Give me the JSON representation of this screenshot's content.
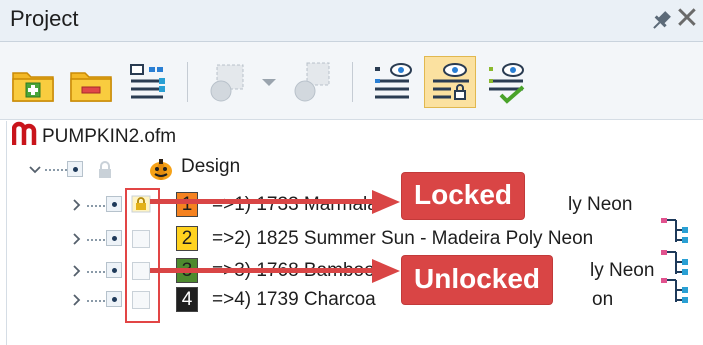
{
  "window": {
    "title": "Project",
    "pin_icon": "pin-icon",
    "close_glyph": "✕"
  },
  "toolbar": {
    "buttons": [
      {
        "icon": "add-folder-icon"
      },
      {
        "icon": "remove-folder-icon"
      },
      {
        "icon": "hierarchy-icon"
      },
      {
        "icon": "group-icon"
      },
      {
        "icon": "dropdown-arrow-icon"
      },
      {
        "icon": "ungroup-icon"
      },
      {
        "icon": "list-view-icon"
      },
      {
        "icon": "view-details-icon",
        "active": true
      },
      {
        "icon": "view-check-icon"
      }
    ]
  },
  "tree": {
    "file_name": "PUMPKIN2.ofm",
    "design_label": "Design",
    "rows": [
      {
        "number": "1",
        "text": "=>1) 1733 Marmala",
        "suffix": "ly Neon",
        "color": "#f58220",
        "text_color": "#1e1e1e",
        "locked": true
      },
      {
        "number": "2",
        "text": "=>2) 1825 Summer Sun - Madeira Poly Neon",
        "suffix": "",
        "color": "#ffd21f",
        "text_color": "#1e1e1e",
        "locked": false
      },
      {
        "number": "3",
        "text": "=>3) 1768 Bamboo",
        "suffix": "ly Neon",
        "color": "#4d8a2e",
        "text_color": "#1e1e1e",
        "locked": false
      },
      {
        "number": "4",
        "text": "=>4) 1739 Charcoa",
        "suffix": "on",
        "color": "#1f1f1f",
        "text_color": "#ffffff",
        "locked": false
      }
    ]
  },
  "annotations": {
    "locked_label": "Locked",
    "unlocked_label": "Unlocked",
    "accent_color": "#d94545"
  }
}
